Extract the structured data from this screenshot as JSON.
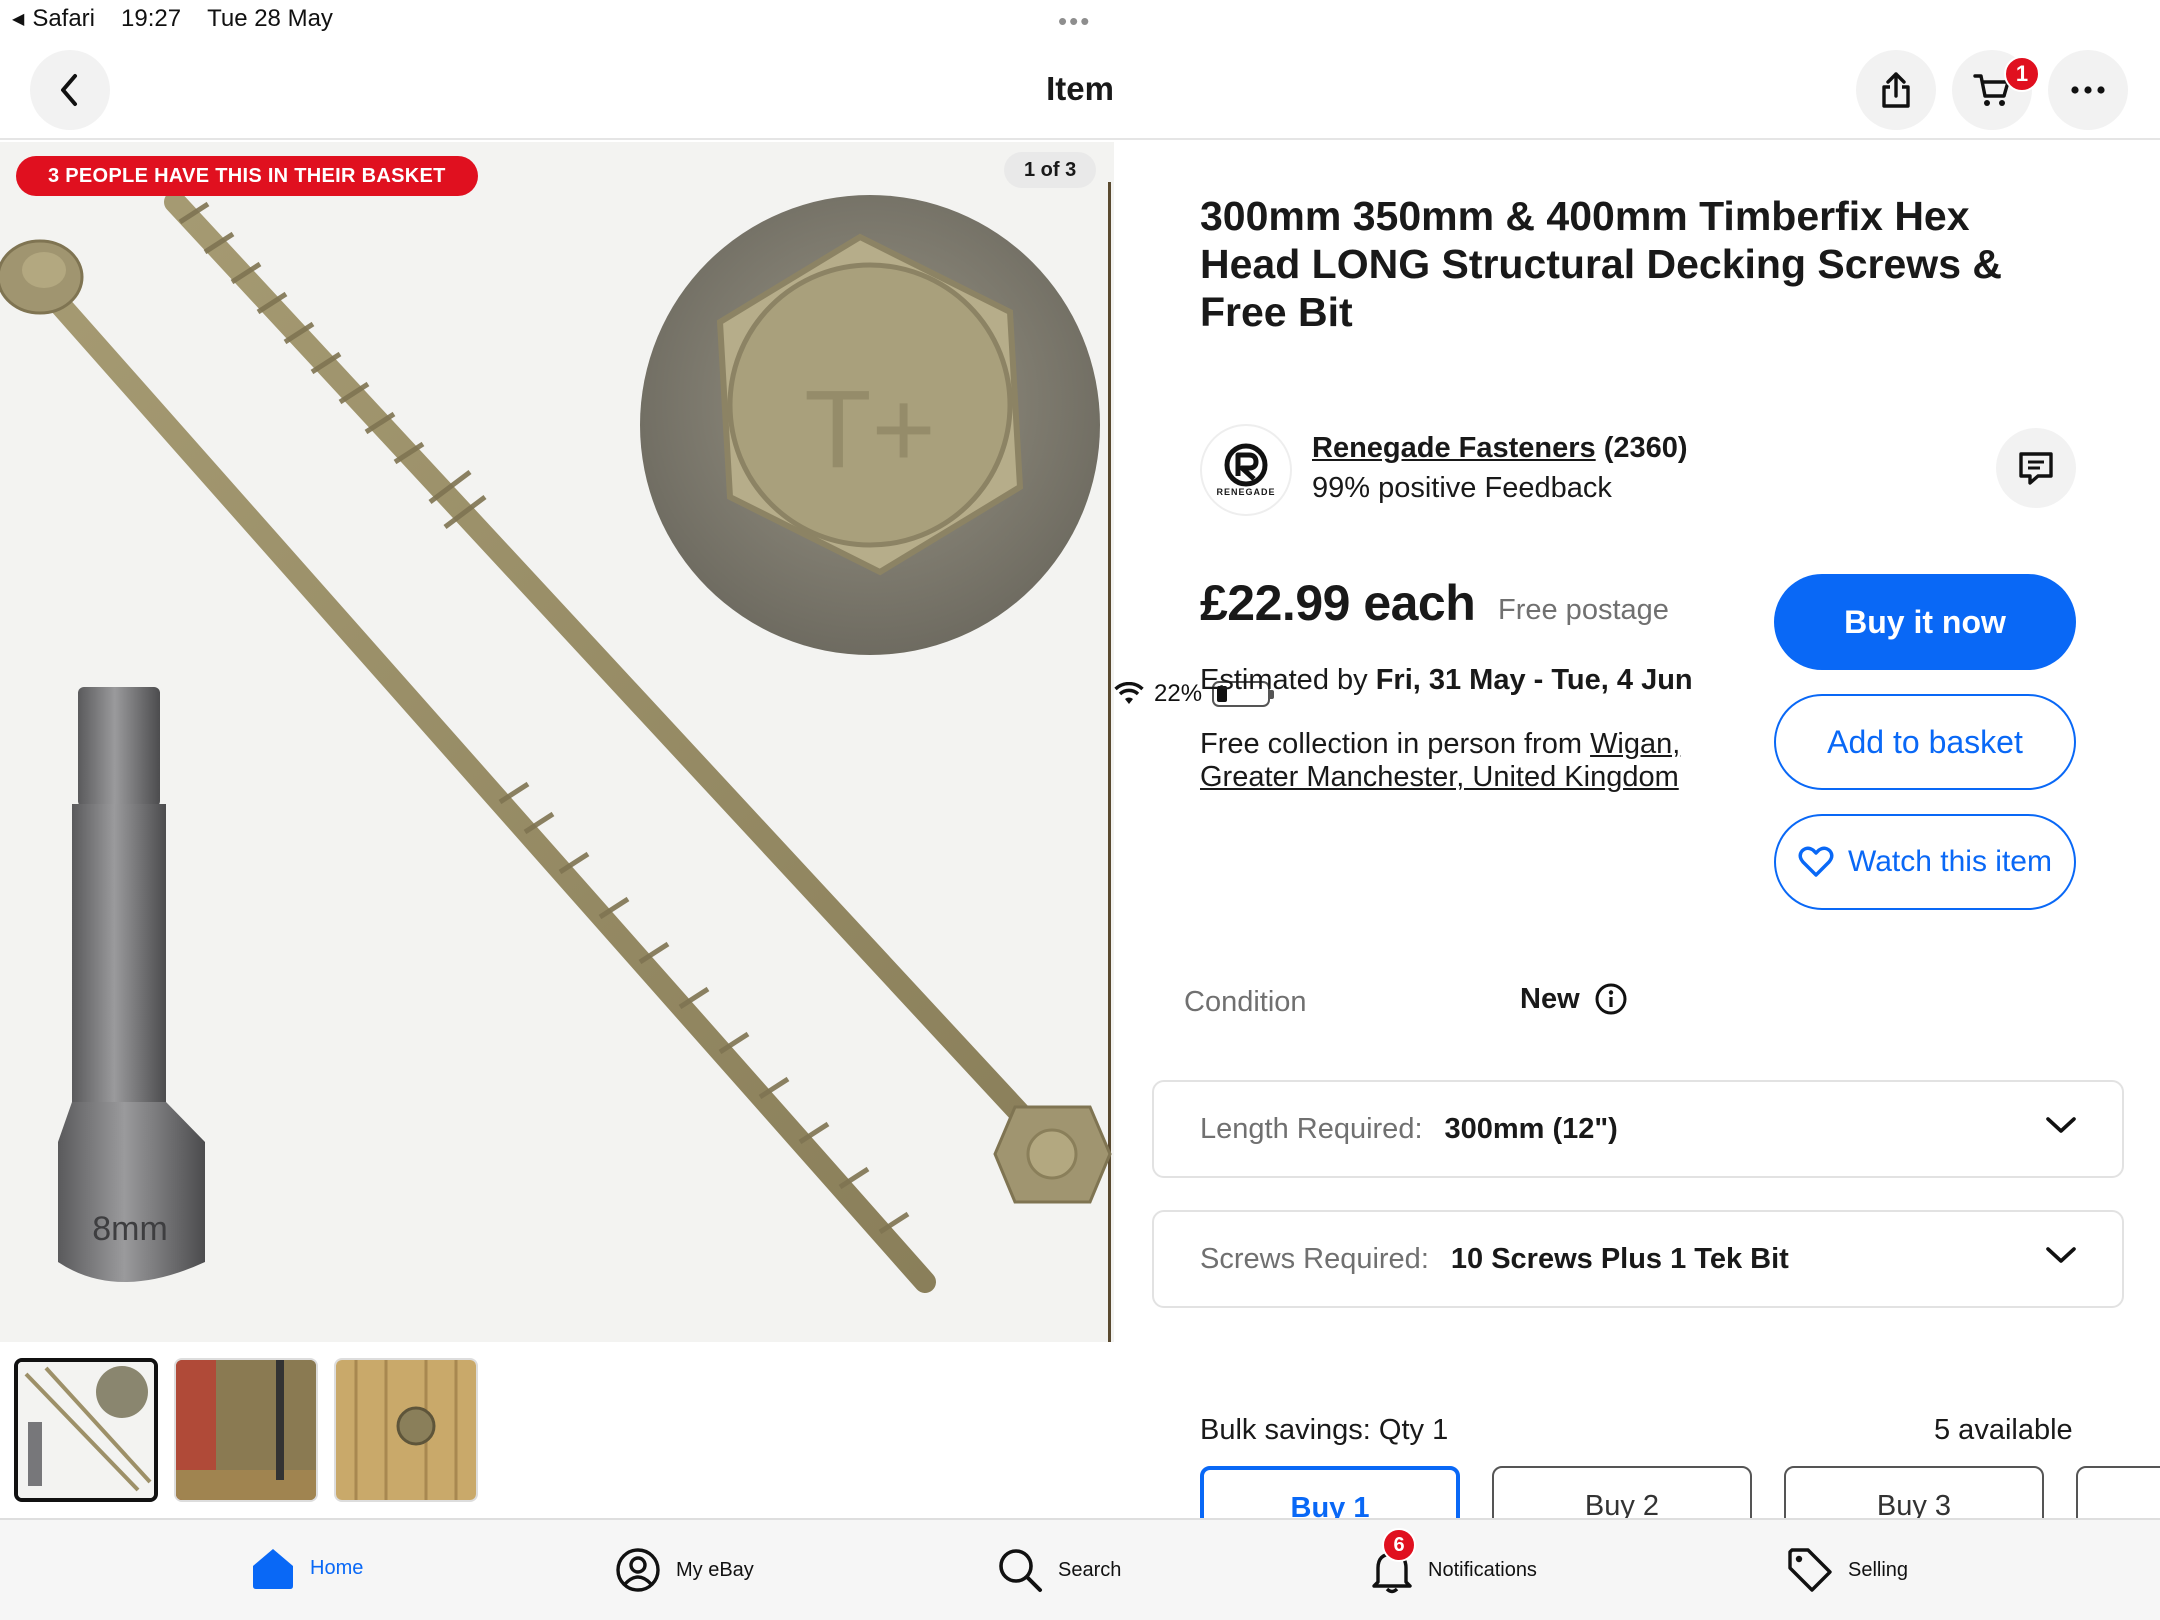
{
  "status_bar": {
    "back_app": "Safari",
    "time": "19:27",
    "date": "Tue 28 May",
    "battery": "22%",
    "battery_level_percent": 22
  },
  "nav": {
    "title": "Item",
    "cart_count": "1"
  },
  "gallery": {
    "banner": "3 PEOPLE HAVE THIS IN THEIR BASKET",
    "counter": "1 of 3",
    "image_text": "8mm",
    "thumbnail_count": 3,
    "selected_thumbnail": 1
  },
  "product": {
    "title": "300mm 350mm & 400mm Timberfix Hex Head LONG Structural Decking Screws & Free Bit",
    "seller": {
      "name": "Renegade Fasteners",
      "count": "(2360)",
      "feedback": "99% positive Feedback",
      "logo_text": "RENEGADE"
    },
    "price": "£22.99 each",
    "postage": "Free postage",
    "estimated_prefix": "Estimated by ",
    "estimated_dates": "Fri, 31 May - Tue, 4 Jun",
    "collection_prefix": "Free collection in person from ",
    "collection_location": "Wigan, Greater Manchester, United Kingdom"
  },
  "actions": {
    "buy_now": "Buy it now",
    "add_to_basket": "Add to basket",
    "watch": "Watch this item"
  },
  "condition": {
    "label": "Condition",
    "value": "New"
  },
  "variations": [
    {
      "label": "Length Required:",
      "value": "300mm (12\")"
    },
    {
      "label": "Screws Required:",
      "value": "10 Screws Plus 1 Tek Bit"
    }
  ],
  "bulk": {
    "label": "Bulk savings: Qty 1",
    "available": "5 available",
    "tabs": [
      "Buy 1",
      "Buy 2",
      "Buy 3"
    ]
  },
  "tabbar": {
    "home": "Home",
    "my_ebay": "My eBay",
    "search": "Search",
    "notifications": "Notifications",
    "notifications_count": "6",
    "selling": "Selling"
  },
  "colors": {
    "accent": "#0968f6",
    "badge_red": "#e0101f",
    "screw_khaki": "#9d9068"
  }
}
